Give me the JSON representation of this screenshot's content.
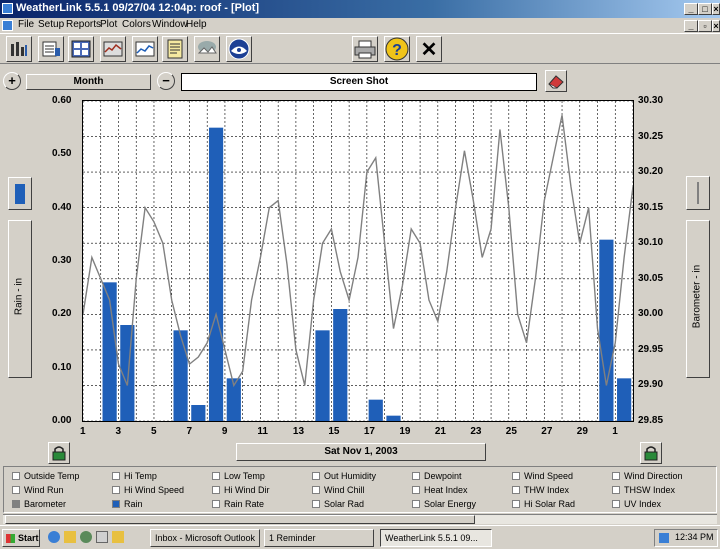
{
  "window": {
    "title": "WeatherLink 5.5.1  09/27/04  12:04p: roof - [Plot]"
  },
  "menu": [
    "File",
    "Setup",
    "Reports",
    "Plot",
    "Colors",
    "Window",
    "Help"
  ],
  "toolbar": {
    "left_icons": [
      "summary-icon",
      "browse-icon",
      "bulletin-icon",
      "strip-chart-icon",
      "plot-icon",
      "notepad-icon",
      "weather-snow-icon",
      "noaa-icon"
    ],
    "right_icons": [
      "printer-icon",
      "help-icon",
      "close-icon"
    ],
    "help_glyph": "?",
    "close_glyph": "✕"
  },
  "plot_controls": {
    "zoom_in_glyph": "+",
    "zoom_out_glyph": "−",
    "span_label": "Month",
    "title_field": "Screen Shot",
    "date_label": "Sat Nov 1, 2003",
    "left_axis_label": "Rain - in",
    "right_axis_label": "Barometer - in"
  },
  "chart_data": {
    "type": "bar",
    "left_axis": {
      "label": "Rain - in",
      "ylim": [
        0,
        0.6
      ],
      "ticks": [
        "0.00",
        "0.10",
        "0.20",
        "0.30",
        "0.40",
        "0.50",
        "0.60"
      ]
    },
    "right_axis": {
      "label": "Barometer - in",
      "ylim": [
        29.85,
        30.3
      ],
      "ticks": [
        "29.85",
        "29.90",
        "29.95",
        "30.00",
        "30.05",
        "30.10",
        "30.15",
        "30.20",
        "30.25",
        "30.30"
      ]
    },
    "x_ticks": [
      "1",
      "3",
      "5",
      "7",
      "9",
      "11",
      "13",
      "15",
      "17",
      "19",
      "21",
      "23",
      "25",
      "27",
      "29",
      "1"
    ],
    "x_range": [
      1,
      32
    ],
    "grid": true,
    "series": [
      {
        "name": "Rain",
        "type": "bar",
        "color": "#1f5fb8",
        "points": [
          {
            "day": 2.5,
            "value": 0.26
          },
          {
            "day": 3.5,
            "value": 0.18
          },
          {
            "day": 6.5,
            "value": 0.17
          },
          {
            "day": 7.5,
            "value": 0.03
          },
          {
            "day": 8.5,
            "value": 0.55
          },
          {
            "day": 9.5,
            "value": 0.08
          },
          {
            "day": 14.5,
            "value": 0.17
          },
          {
            "day": 15.5,
            "value": 0.21
          },
          {
            "day": 17.5,
            "value": 0.04
          },
          {
            "day": 18.5,
            "value": 0.01
          },
          {
            "day": 30.5,
            "value": 0.34
          },
          {
            "day": 31.5,
            "value": 0.08
          }
        ]
      },
      {
        "name": "Barometer",
        "type": "line",
        "color": "#808080",
        "x": [
          1,
          1.5,
          2,
          2.5,
          3,
          3.5,
          4,
          4.5,
          5,
          5.5,
          6,
          6.5,
          7,
          7.5,
          8,
          8.5,
          9,
          9.5,
          10,
          10.5,
          11,
          11.5,
          12,
          12.5,
          13,
          13.5,
          14,
          14.5,
          15,
          15.5,
          16,
          16.5,
          17,
          17.5,
          18,
          18.5,
          19,
          19.5,
          20,
          20.5,
          21,
          21.5,
          22,
          22.5,
          23,
          23.5,
          24,
          24.5,
          25,
          25.5,
          26,
          26.5,
          27,
          27.5,
          28,
          28.5,
          29,
          29.5,
          30,
          30.5,
          31,
          31.5,
          32
        ],
        "y": [
          30.0,
          30.08,
          30.05,
          30.02,
          29.93,
          29.9,
          30.05,
          30.15,
          30.13,
          30.1,
          30.02,
          29.97,
          29.93,
          29.94,
          29.96,
          30.0,
          29.95,
          29.9,
          29.92,
          30.02,
          30.08,
          30.15,
          30.16,
          30.07,
          29.95,
          29.9,
          30.02,
          30.1,
          30.12,
          30.06,
          30.02,
          30.08,
          30.2,
          30.22,
          30.1,
          29.98,
          30.04,
          30.12,
          30.1,
          30.02,
          29.99,
          30.06,
          30.15,
          30.23,
          30.16,
          30.08,
          30.12,
          30.26,
          30.15,
          30.0,
          29.96,
          30.05,
          30.16,
          30.22,
          30.28,
          30.18,
          30.1,
          30.15,
          29.98,
          29.9,
          29.96,
          30.08,
          30.18
        ]
      }
    ]
  },
  "checkboxes": [
    {
      "label": "Outside Temp",
      "state": "off"
    },
    {
      "label": "Hi Temp",
      "state": "off"
    },
    {
      "label": "Low Temp",
      "state": "off"
    },
    {
      "label": "Out Humidity",
      "state": "off"
    },
    {
      "label": "Dewpoint",
      "state": "off"
    },
    {
      "label": "Wind Speed",
      "state": "off"
    },
    {
      "label": "Wind Direction",
      "state": "off"
    },
    {
      "label": "Wind Run",
      "state": "off"
    },
    {
      "label": "Hi Wind Speed",
      "state": "off"
    },
    {
      "label": "Hi Wind Dir",
      "state": "off"
    },
    {
      "label": "Wind Chill",
      "state": "off"
    },
    {
      "label": "Heat Index",
      "state": "off"
    },
    {
      "label": "THW Index",
      "state": "off"
    },
    {
      "label": "THSW Index",
      "state": "off"
    },
    {
      "label": "Barometer",
      "state": "gray"
    },
    {
      "label": "Rain",
      "state": "blue"
    },
    {
      "label": "Rain Rate",
      "state": "off"
    },
    {
      "label": "Solar Rad",
      "state": "off"
    },
    {
      "label": "Solar Energy",
      "state": "off"
    },
    {
      "label": "Hi Solar Rad",
      "state": "off"
    },
    {
      "label": "UV Index",
      "state": "off"
    }
  ],
  "taskbar": {
    "start_label": "Start",
    "buttons": [
      {
        "label": "Inbox - Microsoft Outlook"
      },
      {
        "label": "1 Reminder"
      },
      {
        "label": "WeatherLink 5.5.1  09..."
      }
    ],
    "clock": "12:34 PM"
  }
}
